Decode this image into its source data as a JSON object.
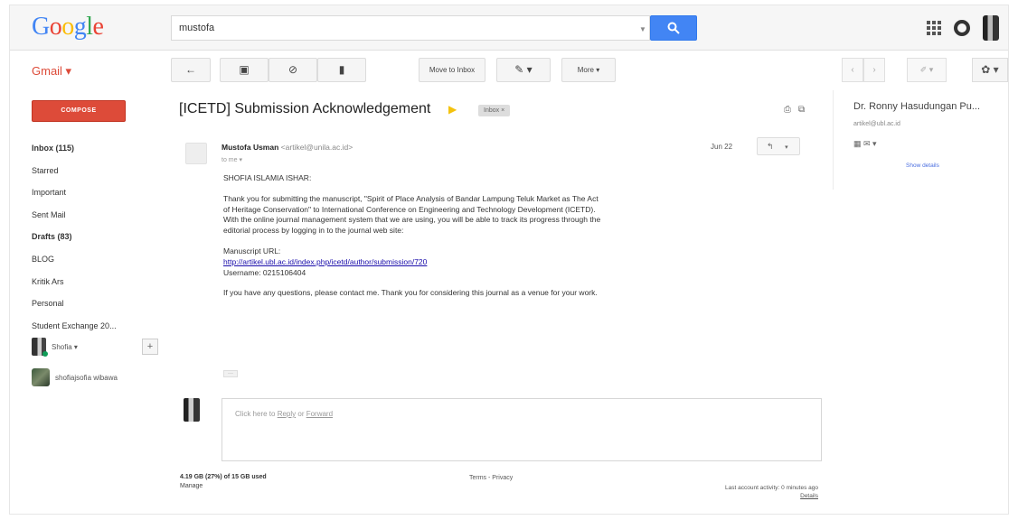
{
  "header": {
    "logo": [
      "G",
      "o",
      "o",
      "g",
      "l",
      "e"
    ],
    "logo_colors": [
      "#4285f4",
      "#ea4335",
      "#fbbc05",
      "#4285f4",
      "#34a853",
      "#ea4335"
    ],
    "search_value": "mustofa"
  },
  "toolbar": {
    "gmail_label": "Gmail ▾",
    "back": "←",
    "archive": "▣",
    "spam": "⊘",
    "delete": "▮",
    "move_to_inbox": "Move to Inbox",
    "labels": "✎ ▾",
    "more": "More ▾",
    "prev": "‹",
    "next": "›",
    "input_tools": "✐ ▾",
    "settings": "✿ ▾"
  },
  "sidebar": {
    "compose": "COMPOSE",
    "items": [
      {
        "label": "Inbox (115)",
        "bold": true
      },
      {
        "label": "Starred",
        "bold": false
      },
      {
        "label": "Important",
        "bold": false
      },
      {
        "label": "Sent Mail",
        "bold": false
      },
      {
        "label": "Drafts (83)",
        "bold": true
      },
      {
        "label": "BLOG",
        "bold": false
      },
      {
        "label": "Kritik Ars",
        "bold": false
      },
      {
        "label": "Personal",
        "bold": false
      },
      {
        "label": "Student Exchange 20...",
        "bold": false
      }
    ],
    "hangout_name": "Shofia ▾",
    "hangout_plus": "+",
    "hangout2_name": "shofiajsofia wibawa"
  },
  "message": {
    "subject": "[ICETD] Submission Acknowledgement",
    "label_chip": "Inbox  ×",
    "sender_name": "Mustofa Usman",
    "sender_email": "<artikel@unila.ac.id>",
    "to_me": "to me ▾",
    "date": "Jun 22",
    "greeting": "SHOFIA ISLAMIA ISHAR:",
    "paragraph1": "Thank you for submitting the manuscript, \"Spirit of Place Analysis of Bandar Lampung Teluk Market as The Act of Heritage Conservation\" to International Conference on  Engineering and Technology Development (ICETD). With the online journal management system that we are using, you will be able to track its progress through the editorial process by logging in to the journal web site:",
    "manuscript_label": "Manuscript URL:",
    "manuscript_url": "http://artikel.ubl.ac.id/index.php/icetd/author/submission/720",
    "username": "Username: 0215106404",
    "closing": "If you have any questions, please contact me. Thank you for considering this journal as a venue for your work.",
    "ellipsis": "···",
    "reply_placeholder_prefix": "Click here to ",
    "reply_link1": "Reply",
    "reply_or": " or ",
    "reply_link2": "Forward"
  },
  "footer": {
    "storage_line1": "4.19 GB (27%) of 15 GB used",
    "storage_line2": "Manage",
    "terms": "Terms - Privacy",
    "activity_line1": "Last account activity: 0 minutes ago",
    "activity_line2": "Details"
  },
  "right_panel": {
    "name": "Dr. Ronny Hasudungan Pu...",
    "email": "artikel@ubl.ac.id",
    "icons": "▦ ✉ ▾",
    "show_details": "Show details"
  }
}
